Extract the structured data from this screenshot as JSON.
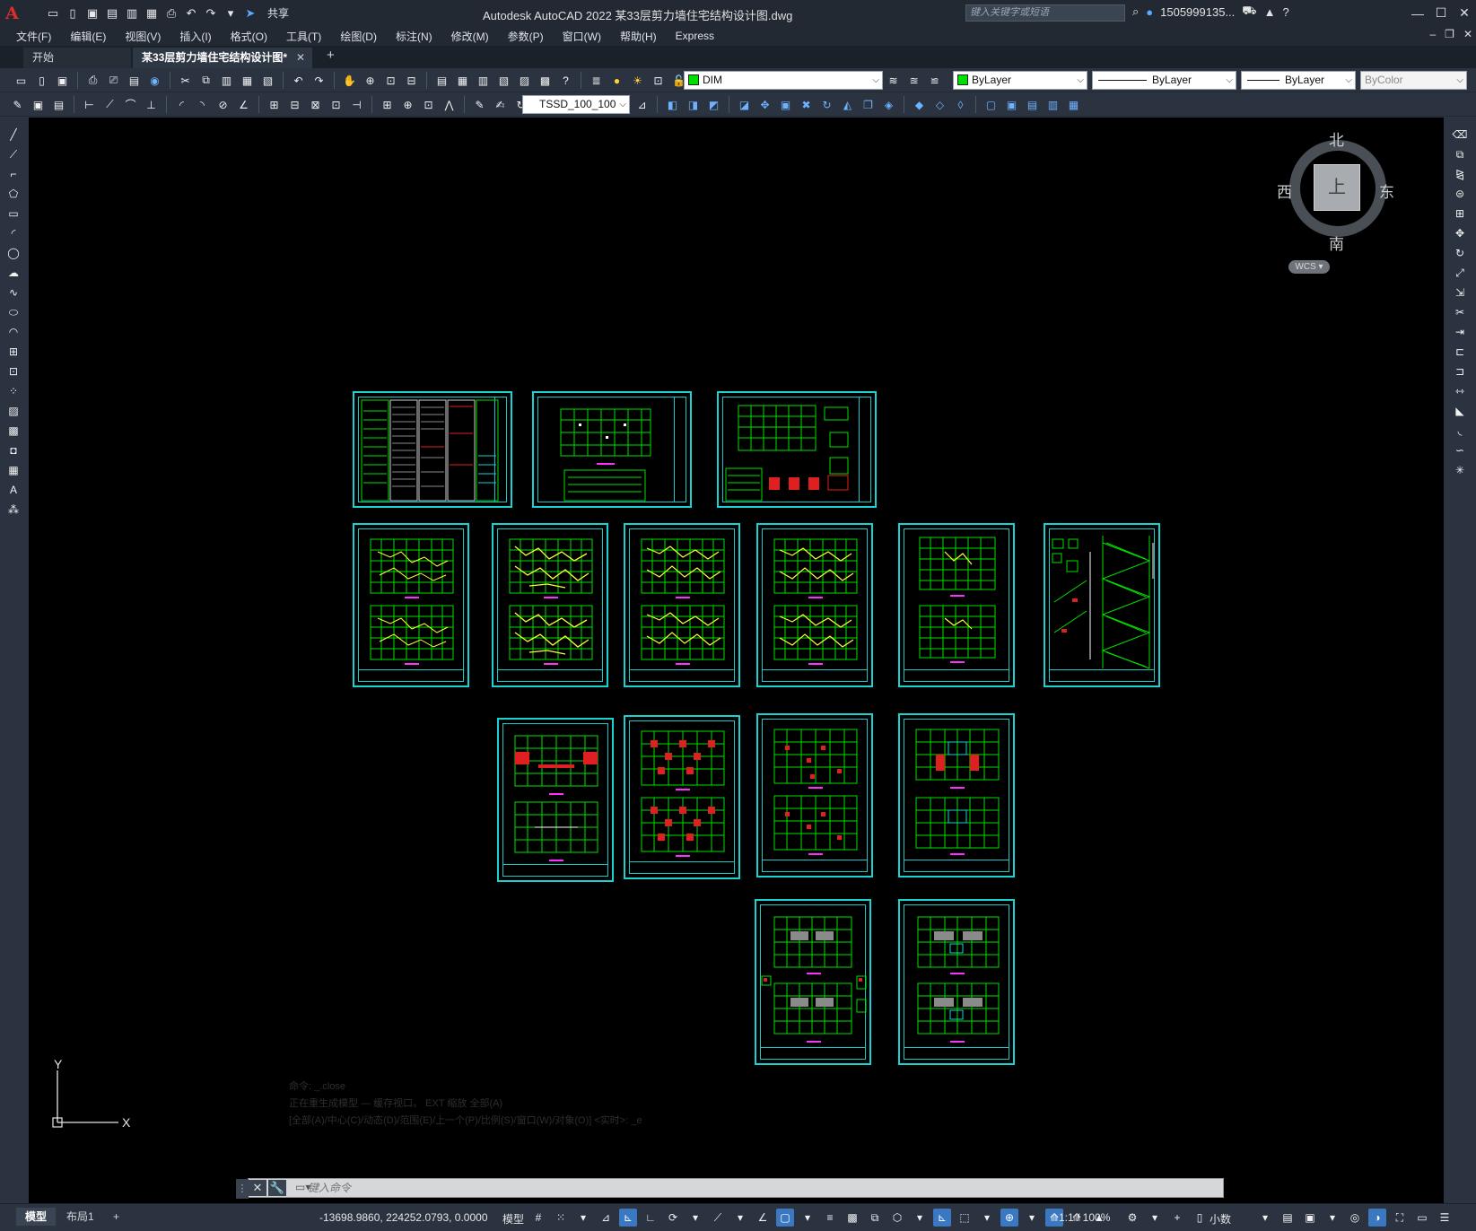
{
  "app": {
    "logo": "A",
    "title": "Autodesk AutoCAD 2022    某33层剪力墙住宅结构设计图.dwg",
    "share_label": "共享",
    "search_placeholder": "键入关键字或短语",
    "user": "1505999135...",
    "help": "?"
  },
  "menu": [
    "文件(F)",
    "编辑(E)",
    "视图(V)",
    "插入(I)",
    "格式(O)",
    "工具(T)",
    "绘图(D)",
    "标注(N)",
    "修改(M)",
    "参数(P)",
    "窗口(W)",
    "帮助(H)",
    "Express"
  ],
  "tabs": {
    "start": "开始",
    "active": "某33层剪力墙住宅结构设计图*",
    "close": "✕",
    "add": "+"
  },
  "properties": {
    "layer": "DIM",
    "layer_color": "#00e000",
    "color": "ByLayer",
    "linetype": "ByLayer",
    "lineweight": "ByLayer",
    "plotstyle": "ByColor",
    "dimstyle": "TSSD_100_100"
  },
  "viewcube": {
    "top_face": "上",
    "north": "北",
    "south": "南",
    "east": "东",
    "west": "西",
    "wcs": "WCS ▾"
  },
  "ucs": {
    "x": "X",
    "y": "Y"
  },
  "command": {
    "placeholder": "键入命令",
    "history": [
      "命令: _.close",
      "正在重生成模型 — 缓存视口。   EXT  缩放  全部(A)",
      "[全部(A)/中心(C)/动态(D)/范围(E)/上一个(P)/比例(S)/窗口(W)/对象(O)] <实时>: _e"
    ]
  },
  "status": {
    "layout_tabs": [
      "模型",
      "布局1"
    ],
    "add": "+",
    "coords": "-13698.9860, 224252.0793, 0.0000",
    "model": "模型",
    "scale": "1:1 / 100%",
    "units": "小数"
  },
  "colors": {
    "sheet_border": "#19d2d2",
    "drawing_green": "#00e000",
    "drawing_yellow": "#ffff33",
    "drawing_red": "#e02020",
    "canvas": "#000000"
  }
}
